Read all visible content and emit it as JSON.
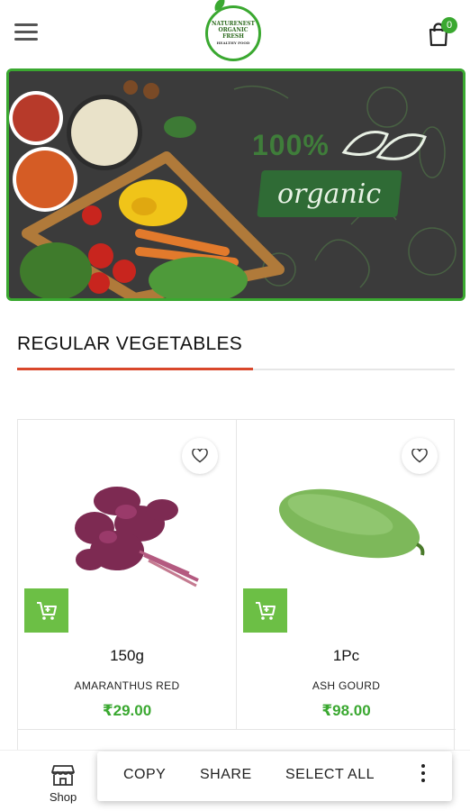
{
  "header": {
    "logo": {
      "line1": "NATURENEST",
      "line2": "ORGANIC FRESH",
      "line3": "HEALTHY FOOD"
    },
    "cart_count": "0"
  },
  "banner": {
    "headline": "100%",
    "subheadline": "organic"
  },
  "section": {
    "title": "REGULAR VEGETABLES"
  },
  "products": [
    {
      "weight": "150g",
      "name": "AMARANTHUS RED",
      "price": "₹29.00"
    },
    {
      "weight": "1Pc",
      "name": "ASH GOURD",
      "price": "₹98.00"
    }
  ],
  "bottom_nav": {
    "shop_label": "Shop"
  },
  "text_toolbar": {
    "copy": "COPY",
    "share": "SHARE",
    "select_all": "SELECT ALL"
  },
  "colors": {
    "brand_green": "#3aa830",
    "add_cart_green": "#6cbf45",
    "accent_red": "#d9472b",
    "banner_bg": "#3a3a3a"
  },
  "icons": [
    "menu-icon",
    "cart-icon",
    "heart-icon",
    "add-to-cart-icon",
    "shop-icon",
    "more-vert-icon"
  ]
}
